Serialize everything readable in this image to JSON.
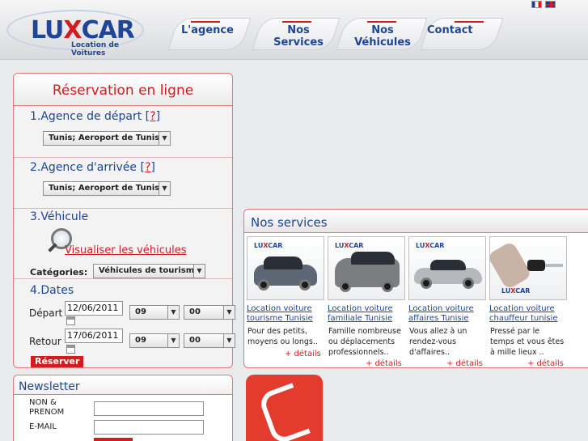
{
  "brand": {
    "name_main": "LU",
    "name_x": "X",
    "name_end": "CAR",
    "tagline": "Location de Voitures"
  },
  "nav": {
    "items": [
      "L'agence",
      "Nos Services",
      "Nos Véhicules",
      "Contact"
    ]
  },
  "languages": [
    "fr-flag-icon",
    "en-flag-icon"
  ],
  "reservation": {
    "title": "Réservation en ligne",
    "departure": {
      "title": "1.Agence de départ",
      "help": "?",
      "value": "Tunis; Aeroport de Tunis-"
    },
    "arrival": {
      "title": "2.Agence d'arrivée",
      "help": "?",
      "value": "Tunis; Aeroport de Tunis-"
    },
    "vehicle": {
      "title": "3.Véhicule",
      "link": "Visualiser les véhicules",
      "category_label": "Catégories:",
      "category_value": "Véhicules de tourisme"
    },
    "dates": {
      "title": "4.Dates",
      "departure_label": "Départ",
      "departure_date": "12/06/2011",
      "departure_hour": "09",
      "departure_min": "00",
      "return_label": "Retour",
      "return_date": "17/06/2011",
      "return_hour": "09",
      "return_min": "00"
    },
    "submit": "Réserver"
  },
  "services": {
    "title": "Nos services",
    "cards": [
      {
        "title": "Location voiture tourisme Tunisie",
        "desc": "Pour des petits, moyens ou longs..",
        "more": "+ détails"
      },
      {
        "title": "Location voiture familiale Tunisie",
        "desc": "Famille nombreuse ou déplacements professionnels..",
        "more": "+ détails"
      },
      {
        "title": "Location voiture affaires Tunisie",
        "desc": "Vous allez à un rendez-vous d'affaires..",
        "more": "+ détails"
      },
      {
        "title": "Location voiture chauffeur tunisie",
        "desc": "Pressé par le temps et vous êtes à mille lieux ..",
        "more": "+ détails"
      }
    ]
  },
  "newsletter": {
    "title": "Newsletter",
    "name_label": "NON & PRENOM",
    "email_label": "E-MAIL"
  },
  "colors": {
    "accent_red": "#d41c20",
    "brand_blue": "#1f4596"
  }
}
